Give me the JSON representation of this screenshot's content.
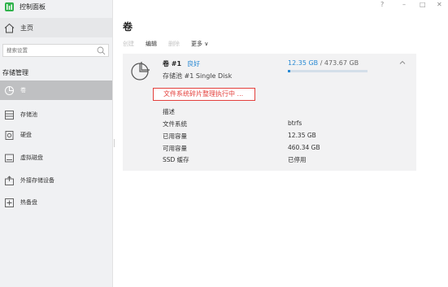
{
  "app": {
    "title": "控制面板"
  },
  "window_controls": [
    "?",
    "–",
    "□",
    "✕"
  ],
  "sidebar": {
    "home_label": "主页",
    "search_placeholder": "搜索设置",
    "section_title": "存储管理",
    "items": [
      {
        "label": "卷",
        "icon": "volume-icon",
        "active": true
      },
      {
        "label": "存储池",
        "icon": "storage-pool-icon",
        "active": false
      },
      {
        "label": "硬盘",
        "icon": "hdd-icon",
        "active": false
      },
      {
        "label": "虚拟磁盘",
        "icon": "virtual-disk-icon",
        "active": false
      },
      {
        "label": "外接存储设备",
        "icon": "external-storage-icon",
        "active": false
      },
      {
        "label": "热备盘",
        "icon": "hot-spare-icon",
        "active": false
      }
    ]
  },
  "main": {
    "title": "卷",
    "toolbar": {
      "create": "创建",
      "edit": "编辑",
      "delete": "删除",
      "more": "更多 ∨"
    },
    "volume": {
      "name": "卷 #1",
      "status": "良好",
      "pool_line": "存储池 #1  Single Disk",
      "used_display": "12.35 GB",
      "total_display": "/ 473.67 GB",
      "usage_fraction": 0.026,
      "warning": "文件系统碎片整理执行中 ...",
      "properties": [
        {
          "label": "描述",
          "value": ""
        },
        {
          "label": "文件系统",
          "value": "btrfs"
        },
        {
          "label": "已用容量",
          "value": "12.35 GB"
        },
        {
          "label": "可用容量",
          "value": "460.34 GB"
        },
        {
          "label": "SSD 缓存",
          "value": "已停用"
        }
      ]
    }
  },
  "colors": {
    "accent": "#2a8ad4",
    "warning": "#e4403c",
    "logo": "#2fb24b",
    "sidebar_bg": "#f0f1f3",
    "active_bg": "#bfc0c2"
  }
}
